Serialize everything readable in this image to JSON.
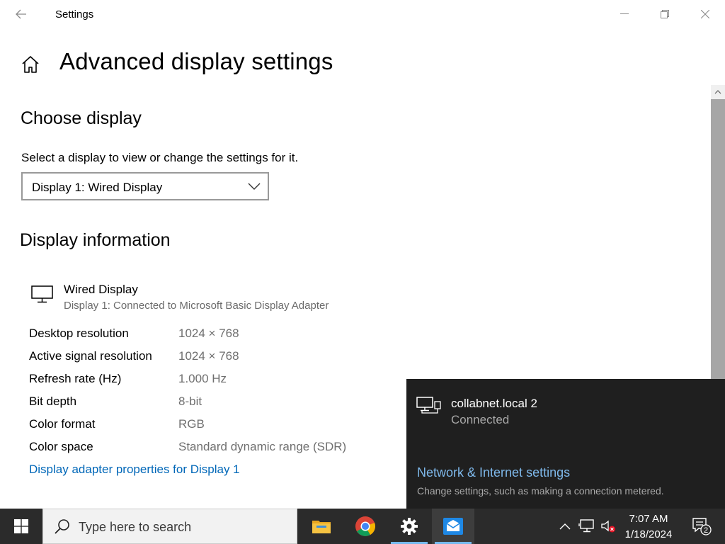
{
  "window": {
    "title": "Settings",
    "controls": {
      "minimize": "minimize",
      "maximize": "maximize",
      "close": "close"
    }
  },
  "page": {
    "title": "Advanced display settings"
  },
  "choose_display": {
    "heading": "Choose display",
    "caption": "Select a display to view or change the settings for it.",
    "selected": "Display 1: Wired Display"
  },
  "display_info": {
    "heading": "Display information",
    "name": "Wired Display",
    "subtitle": "Display 1: Connected to Microsoft Basic Display Adapter",
    "rows": [
      {
        "label": "Desktop resolution",
        "value": "1024 × 768"
      },
      {
        "label": "Active signal resolution",
        "value": "1024 × 768"
      },
      {
        "label": "Refresh rate (Hz)",
        "value": "1.000 Hz"
      },
      {
        "label": "Bit depth",
        "value": "8-bit"
      },
      {
        "label": "Color format",
        "value": "RGB"
      },
      {
        "label": "Color space",
        "value": "Standard dynamic range (SDR)"
      }
    ],
    "adapter_link": "Display adapter properties for Display 1"
  },
  "network_flyout": {
    "network_name": "collabnet.local 2",
    "status": "Connected",
    "settings_link": "Network & Internet settings",
    "settings_desc": "Change settings, such as making a connection metered."
  },
  "taskbar": {
    "search_placeholder": "Type here to search",
    "apps": [
      "file-explorer",
      "chrome",
      "settings",
      "mail-app"
    ],
    "time": "7:07 AM",
    "date": "1/18/2024",
    "notification_count": "2"
  },
  "colors": {
    "accent_link": "#0067b8",
    "flyout_bg": "#1f1f1f",
    "taskbar_bg": "#2b2b2b"
  }
}
